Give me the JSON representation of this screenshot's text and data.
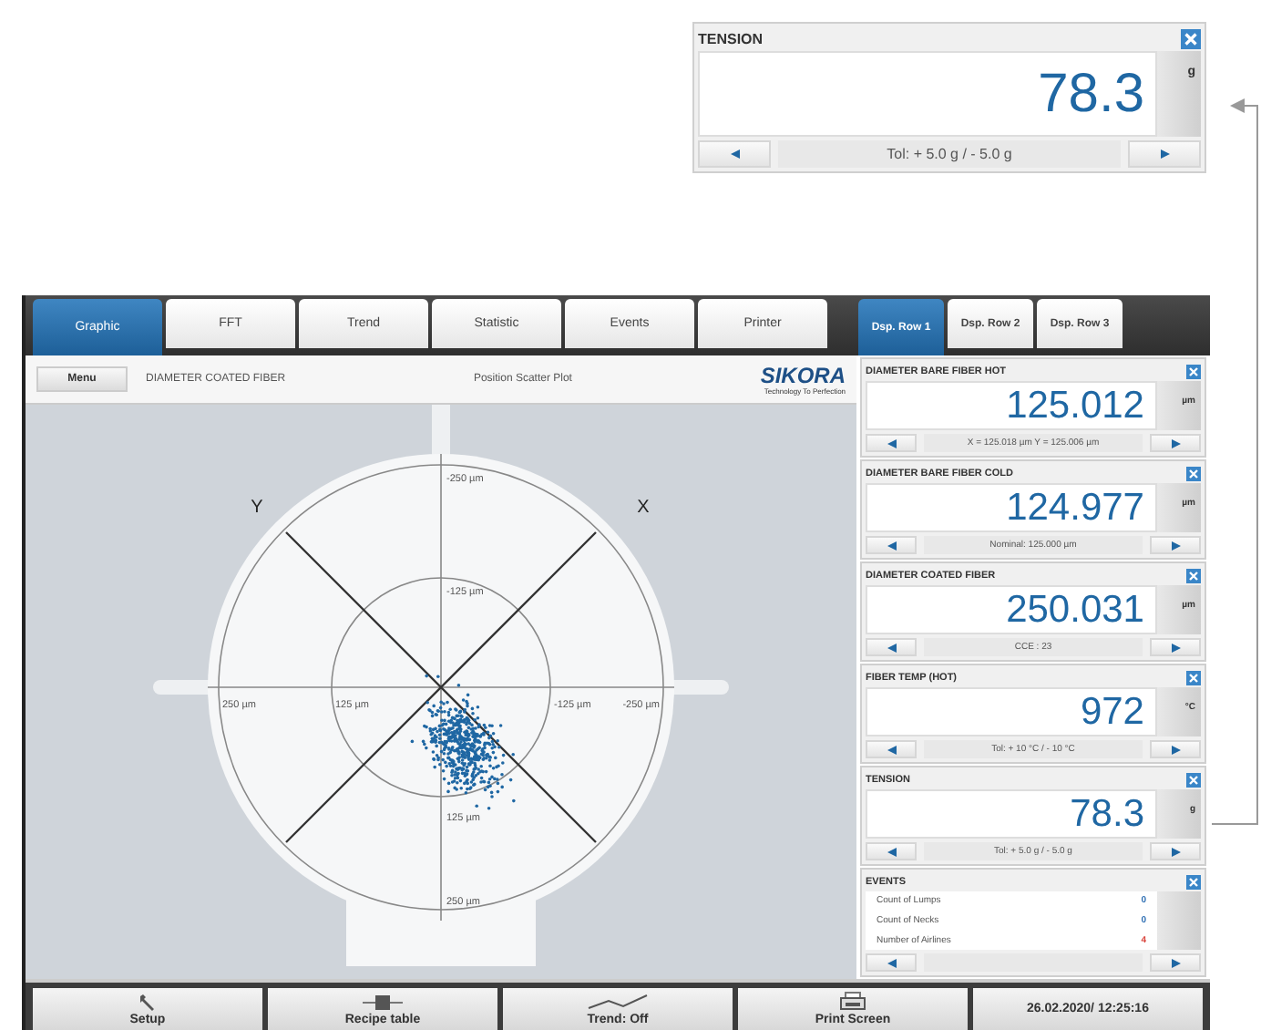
{
  "callout": {
    "title": "TENSION",
    "value": "78.3",
    "unit": "g",
    "footer": "Tol: + 5.0 g / - 5.0 g"
  },
  "tabs": [
    {
      "label": "Graphic",
      "selected": true
    },
    {
      "label": "FFT",
      "selected": false
    },
    {
      "label": "Trend",
      "selected": false
    },
    {
      "label": "Statistic",
      "selected": false
    },
    {
      "label": "Events",
      "selected": false
    },
    {
      "label": "Printer",
      "selected": false
    }
  ],
  "display_tabs": [
    {
      "label": "Dsp. Row 1",
      "selected": true
    },
    {
      "label": "Dsp. Row 2",
      "selected": false
    },
    {
      "label": "Dsp. Row 3",
      "selected": false
    }
  ],
  "toolbar": {
    "menu": "Menu",
    "measurement": "DIAMETER COATED FIBER",
    "view": "Position Scatter Plot",
    "logo": "SIKORA",
    "slogan": "Technology To Perfection"
  },
  "plot": {
    "axis_names": [
      "Y",
      "X"
    ],
    "tick_labels": [
      "-250 µm",
      "-125 µm",
      "250 µm",
      "125 µm",
      "-125 µm",
      "-250 µm",
      "125 µm",
      "250 µm"
    ]
  },
  "widgets": [
    {
      "title": "DIAMETER BARE FIBER HOT",
      "value": "125.012",
      "unit": "µm",
      "footer": "X = 125.018 µm  Y = 125.006 µm"
    },
    {
      "title": "DIAMETER BARE FIBER COLD",
      "value": "124.977",
      "unit": "µm",
      "footer": "Nominal: 125.000 µm"
    },
    {
      "title": "DIAMETER COATED FIBER",
      "value": "250.031",
      "unit": "µm",
      "footer": "CCE : 23"
    },
    {
      "title": "FIBER TEMP (HOT)",
      "value": "972",
      "unit": "°C",
      "footer": "Tol: + 10 °C / - 10 °C"
    },
    {
      "title": "TENSION",
      "value": "78.3",
      "unit": "g",
      "footer": "Tol: + 5.0 g / - 5.0 g"
    }
  ],
  "events": {
    "title": "EVENTS",
    "rows": [
      {
        "label": "Count of Lumps",
        "value": "0",
        "color": "#2f6fb3"
      },
      {
        "label": "Count of Necks",
        "value": "0",
        "color": "#2f6fb3"
      },
      {
        "label": "Number of Airlines",
        "value": "4",
        "color": "#d9423a"
      }
    ]
  },
  "bottom_buttons": [
    {
      "label": "Setup",
      "kind": "wrench"
    },
    {
      "label": "Recipe table",
      "kind": "recipe"
    },
    {
      "label": "Trend: Off",
      "kind": "trend"
    },
    {
      "label": "Print Screen",
      "kind": "printer"
    }
  ],
  "datetime": "26.02.2020/ 12:25:16"
}
